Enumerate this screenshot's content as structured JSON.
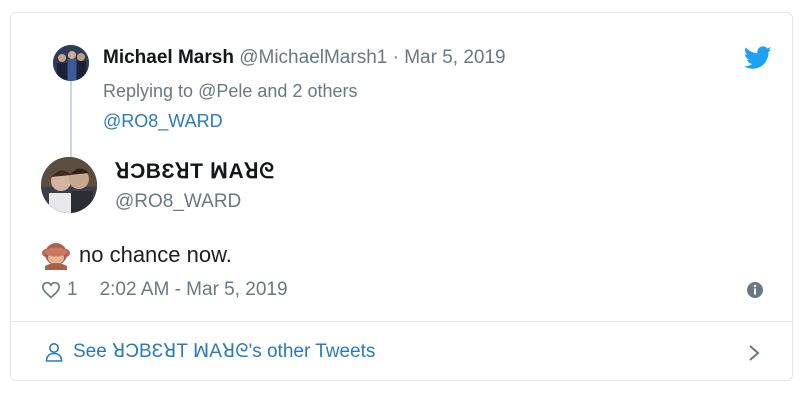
{
  "parent": {
    "name": "Michael Marsh",
    "handle": "@MichaelMarsh1",
    "separator": "·",
    "date": "Mar 5, 2019",
    "replying_prefix": "Replying to",
    "replying_target": "@Pele",
    "replying_suffix": "and 2 others",
    "mention": "@RO8_WARD"
  },
  "tweet": {
    "display_name": "ꓤƆBƐꓤT ꟽAꓤᘓ",
    "handle": "@RO8_WARD",
    "text": "no chance now.",
    "likes": "1",
    "timestamp": "2:02 AM - Mar 5, 2019"
  },
  "footer": {
    "see_prefix": "See",
    "display_name": "ꓤƆBƐꓤT ꟽAꓤᘓ",
    "see_suffix": "'s other Tweets"
  },
  "colors": {
    "link": "#2b7bb9",
    "muted": "#697882",
    "twitter_blue": "#1da1f2",
    "border": "#e1e8ed"
  },
  "icons": [
    "twitter-bird-icon",
    "see-no-evil-monkey-icon",
    "heart-icon",
    "info-icon",
    "person-icon",
    "chevron-right-icon"
  ]
}
